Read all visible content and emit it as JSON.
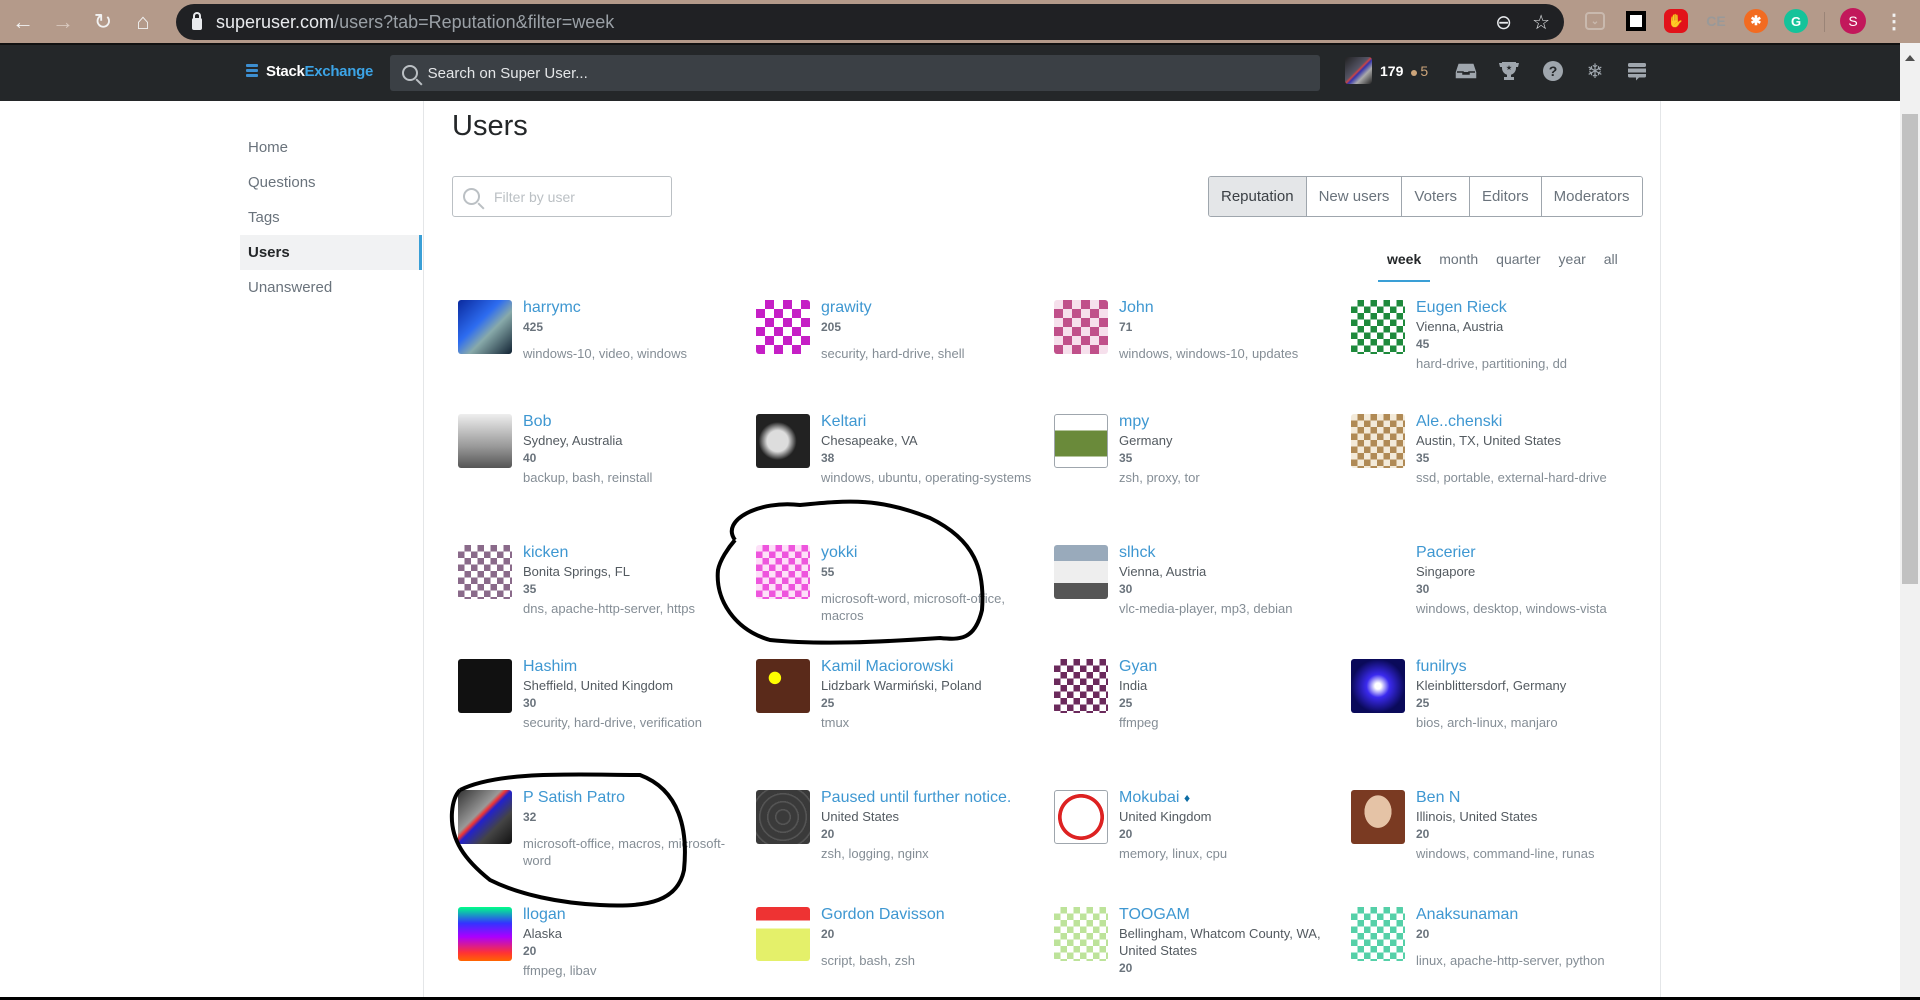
{
  "browser": {
    "url_host": "superuser.com",
    "url_path": "/users?tab=Reputation&filter=week",
    "profile_initial": "S",
    "extensions": [
      "pocket-icon",
      "square-extension-icon",
      "adblock-icon",
      "cc-extension-icon",
      "orange-extension-icon",
      "grammarly-icon"
    ]
  },
  "topbar": {
    "logo_stack": "Stack",
    "logo_exchange": "Exchange",
    "search_placeholder": "Search on Super User...",
    "reputation": "179",
    "bronze_badges": "5"
  },
  "sidebar": {
    "items": [
      {
        "label": "Home",
        "active": false
      },
      {
        "label": "Questions",
        "active": false
      },
      {
        "label": "Tags",
        "active": false
      },
      {
        "label": "Users",
        "active": true
      },
      {
        "label": "Unanswered",
        "active": false
      }
    ]
  },
  "page": {
    "title": "Users",
    "filter_placeholder": "Filter by user",
    "tabs": [
      {
        "label": "Reputation",
        "active": true
      },
      {
        "label": "New users",
        "active": false
      },
      {
        "label": "Voters",
        "active": false
      },
      {
        "label": "Editors",
        "active": false
      },
      {
        "label": "Moderators",
        "active": false
      }
    ],
    "periods": [
      {
        "label": "week",
        "active": true
      },
      {
        "label": "month",
        "active": false
      },
      {
        "label": "quarter",
        "active": false
      },
      {
        "label": "year",
        "active": false
      },
      {
        "label": "all",
        "active": false
      }
    ]
  },
  "users": [
    {
      "name": "harrymc",
      "location": "",
      "rep": "425",
      "tags": "windows-10, video, windows"
    },
    {
      "name": "grawity",
      "location": "",
      "rep": "205",
      "tags": "security, hard-drive, shell"
    },
    {
      "name": "John",
      "location": "",
      "rep": "71",
      "tags": "windows, windows-10, updates"
    },
    {
      "name": "Eugen Rieck",
      "location": "Vienna, Austria",
      "rep": "45",
      "tags": "hard-drive, partitioning, dd"
    },
    {
      "name": "Bob",
      "location": "Sydney, Australia",
      "rep": "40",
      "tags": "backup, bash, reinstall"
    },
    {
      "name": "Keltari",
      "location": "Chesapeake, VA",
      "rep": "38",
      "tags": "windows, ubuntu, operating-systems"
    },
    {
      "name": "mpy",
      "location": "Germany",
      "rep": "35",
      "tags": "zsh, proxy, tor"
    },
    {
      "name": "Ale..chenski",
      "location": "Austin, TX, United States",
      "rep": "35",
      "tags": "ssd, portable, external-hard-drive"
    },
    {
      "name": "kicken",
      "location": "Bonita Springs, FL",
      "rep": "35",
      "tags": "dns, apache-http-server, https"
    },
    {
      "name": "yokki",
      "location": "",
      "rep": "55",
      "tags": "microsoft-word, microsoft-office, macros"
    },
    {
      "name": "slhck",
      "location": "Vienna, Austria",
      "rep": "30",
      "tags": "vlc-media-player, mp3, debian"
    },
    {
      "name": "Pacerier",
      "location": "Singapore",
      "rep": "30",
      "tags": "windows, desktop, windows-vista"
    },
    {
      "name": "Hashim",
      "location": "Sheffield, United Kingdom",
      "rep": "30",
      "tags": "security, hard-drive, verification"
    },
    {
      "name": "Kamil Maciorowski",
      "location": "Lidzbark Warmiński, Poland",
      "rep": "25",
      "tags": "tmux"
    },
    {
      "name": "Gyan",
      "location": "India",
      "rep": "25",
      "tags": "ffmpeg"
    },
    {
      "name": "funilrys",
      "location": "Kleinblittersdorf, Germany",
      "rep": "25",
      "tags": "bios, arch-linux, manjaro"
    },
    {
      "name": "P Satish Patro",
      "location": "",
      "rep": "32",
      "tags": "microsoft-office, macros, microsoft-word"
    },
    {
      "name": "Paused until further notice.",
      "location": "United States",
      "rep": "20",
      "tags": "zsh, logging, nginx"
    },
    {
      "name": "Mokubai",
      "moderator": "♦",
      "location": "United Kingdom",
      "rep": "20",
      "tags": "memory, linux, cpu"
    },
    {
      "name": "Ben N",
      "location": "Illinois, United States",
      "rep": "20",
      "tags": "windows, command-line, runas"
    },
    {
      "name": "llogan",
      "location": "Alaska",
      "rep": "20",
      "tags": "ffmpeg, libav"
    },
    {
      "name": "Gordon Davisson",
      "location": "",
      "rep": "20",
      "tags": "script, bash, zsh"
    },
    {
      "name": "TOOGAM",
      "location": "Bellingham, Whatcom County, WA, United States",
      "rep": "20",
      "tags": ""
    },
    {
      "name": "Anaksunaman",
      "location": "",
      "rep": "20",
      "tags": "linux, apache-http-server, python"
    }
  ],
  "colors": {
    "link": "#3e97d1",
    "active_tab_underline": "#3a9fd6",
    "topbar_bg": "#242729"
  }
}
